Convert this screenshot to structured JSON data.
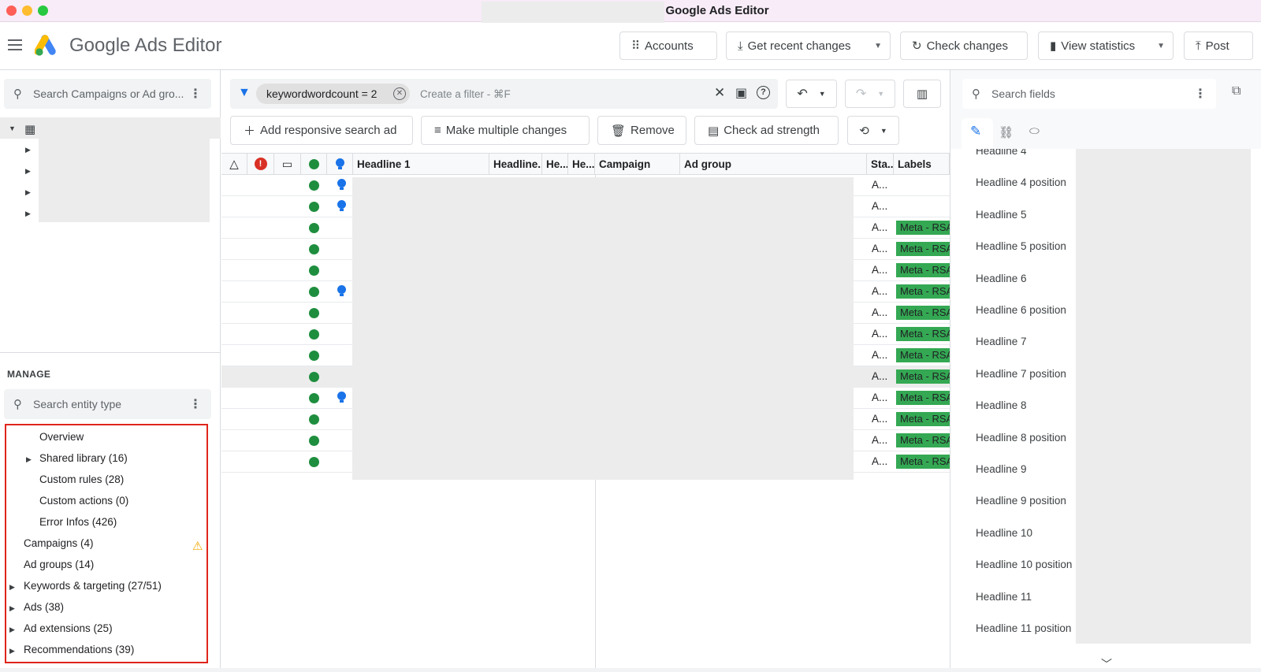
{
  "window": {
    "title": "Google Ads Editor"
  },
  "header": {
    "app_name": "Google Ads Editor",
    "buttons": {
      "accounts": "Accounts",
      "get_recent": "Get recent changes",
      "check_changes": "Check changes",
      "view_statistics": "View statistics",
      "post": "Post"
    }
  },
  "left": {
    "search_placeholder": "Search Campaigns or Ad gro...",
    "manage_heading": "MANAGE",
    "entity_search_placeholder": "Search entity type",
    "manage_items": [
      "Overview",
      "Shared library (16)",
      "Custom rules (28)",
      "Custom actions (0)",
      "Error Infos (426)",
      "Campaigns (4)",
      "Ad groups (14)",
      "Keywords & targeting (27/51)",
      "Ads (38)",
      "Ad extensions (25)",
      "Recommendations (39)"
    ]
  },
  "filter": {
    "chip": "keywordwordcount = 2",
    "placeholder": "Create a filter - ⌘F"
  },
  "actions": {
    "add_rsa": "Add responsive search ad",
    "multiple_changes": "Make multiple changes",
    "remove": "Remove",
    "check_strength": "Check ad strength"
  },
  "grid": {
    "columns": [
      "Headline 1",
      "Headline...",
      "He...",
      "He...",
      "Campaign",
      "Ad group",
      "Sta...",
      "Labels"
    ],
    "status_text": "A...",
    "label_text": "Meta - RSA",
    "rows_bulb": [
      true,
      true,
      false,
      false,
      false,
      true,
      false,
      false,
      false,
      false,
      true,
      false,
      false,
      false
    ],
    "rows_label": [
      false,
      false,
      true,
      true,
      true,
      true,
      true,
      true,
      true,
      true,
      true,
      true,
      true,
      true
    ]
  },
  "right": {
    "search_placeholder": "Search fields",
    "fields": [
      "Headline 4",
      "Headline 4 position",
      "Headline 5",
      "Headline 5 position",
      "Headline 6",
      "Headline 6 position",
      "Headline 7",
      "Headline 7 position",
      "Headline 8",
      "Headline 8 position",
      "Headline 9",
      "Headline 9 position",
      "Headline 10",
      "Headline 10 position",
      "Headline 11",
      "Headline 11 position"
    ]
  },
  "colors": {
    "status_green": "#1e8e3e",
    "label_green": "#34a853",
    "info_blue": "#1a73e8",
    "error_red": "#d93025",
    "highlight_red": "#e0251b",
    "warning": "#f0a800"
  }
}
